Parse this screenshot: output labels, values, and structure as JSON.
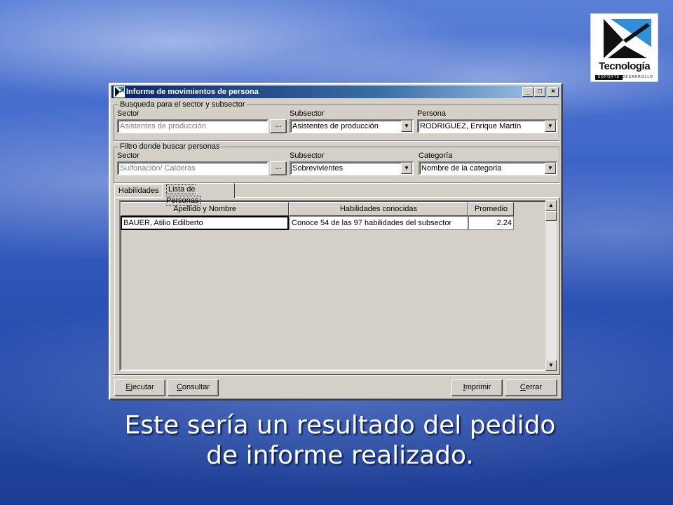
{
  "logo": {
    "name": "Tecnología",
    "sub_left": "SOPORTE",
    "sub_right": "DESARROLLO"
  },
  "window": {
    "title": "Informe de movimientos de persona",
    "min_label": "_",
    "max_label": "□",
    "close_label": "×"
  },
  "search_group": {
    "title": "Busqueda para el sector y subsector",
    "sector_label": "Sector",
    "sector_value": "Asistentes de producción",
    "browse_label": "...",
    "subsector_label": "Subsector",
    "subsector_value": "Asistentes de producción",
    "persona_label": "Persona",
    "persona_value": "RODRIGUEZ, Enrique Martín"
  },
  "filter_group": {
    "title": "Filtro donde buscar personas",
    "sector_label": "Sector",
    "sector_value": "Sulfonación/ Calderas",
    "browse_label": "...",
    "subsector_label": "Subsector",
    "subsector_value": "Sobrevivientes",
    "categoria_label": "Categoría",
    "categoria_value": "Nombre de la categoria"
  },
  "tabs": [
    {
      "label": "Habilidades"
    },
    {
      "label": "Lista de Personas"
    }
  ],
  "grid": {
    "columns": [
      "Apellido y Nombre",
      "Habilidades conocidas",
      "Promedio"
    ],
    "rows": [
      [
        "BAUER, Atilio Edilberto",
        "Conoce 54 de las 97 habilidades del subsector",
        "2.24"
      ]
    ]
  },
  "buttons": {
    "ejecutar_first": "E",
    "ejecutar_rest": "jecutar",
    "consultar_first": "C",
    "consultar_rest": "onsultar",
    "imprimir_first": "I",
    "imprimir_rest": "mprimir",
    "cerrar_first": "C",
    "cerrar_rest": "errar"
  },
  "caption": {
    "line1": "Este sería un resultado del pedido",
    "line2": "de informe realizado."
  }
}
